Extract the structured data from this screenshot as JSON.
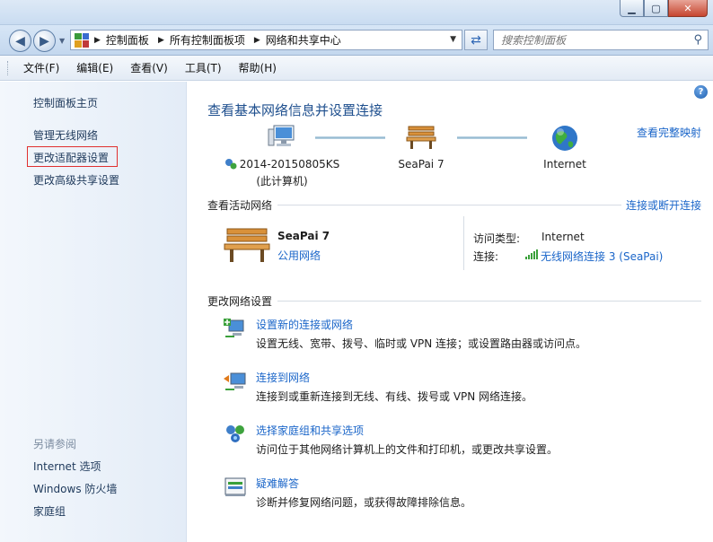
{
  "window": {
    "controls": {
      "minimize": "▁",
      "maximize": "▢",
      "close": "✕"
    }
  },
  "address": {
    "crumbs": [
      "控制面板",
      "所有控制面板项",
      "网络和共享中心"
    ],
    "search_placeholder": "搜索控制面板"
  },
  "menu": [
    "文件(F)",
    "编辑(E)",
    "查看(V)",
    "工具(T)",
    "帮助(H)"
  ],
  "sidebar": {
    "items": [
      "控制面板主页",
      "管理无线网络",
      "更改适配器设置",
      "更改高级共享设置"
    ],
    "see_also_heading": "另请参阅",
    "see_also": [
      "Internet 选项",
      "Windows 防火墙",
      "家庭组"
    ]
  },
  "main": {
    "title": "查看基本网络信息并设置连接",
    "full_map_link": "查看完整映射",
    "map": {
      "computer_name": "2014-20150805KS",
      "computer_sub": "(此计算机)",
      "network_name": "SeaPai  7",
      "internet": "Internet"
    },
    "active_section": {
      "heading": "查看活动网络",
      "action_link": "连接或断开连接",
      "network_name": "SeaPai  7",
      "network_category": "公用网络",
      "access_type_label": "访问类型:",
      "access_type_value": "Internet",
      "connection_label": "连接:",
      "connection_value": "无线网络连接 3 (SeaPai)"
    },
    "change_section": {
      "heading": "更改网络设置",
      "tasks": [
        {
          "title": "设置新的连接或网络",
          "desc": "设置无线、宽带、拨号、临时或 VPN 连接；或设置路由器或访问点。",
          "icon": "new-connection-icon"
        },
        {
          "title": "连接到网络",
          "desc": "连接到或重新连接到无线、有线、拨号或 VPN 网络连接。",
          "icon": "connect-network-icon"
        },
        {
          "title": "选择家庭组和共享选项",
          "desc": "访问位于其他网络计算机上的文件和打印机，或更改共享设置。",
          "icon": "homegroup-icon"
        },
        {
          "title": "疑难解答",
          "desc": "诊断并修复网络问题，或获得故障排除信息。",
          "icon": "troubleshoot-icon"
        }
      ]
    }
  },
  "colors": {
    "link": "#1b66c9",
    "title": "#1e4f8e",
    "selection_box": "#e03030"
  }
}
